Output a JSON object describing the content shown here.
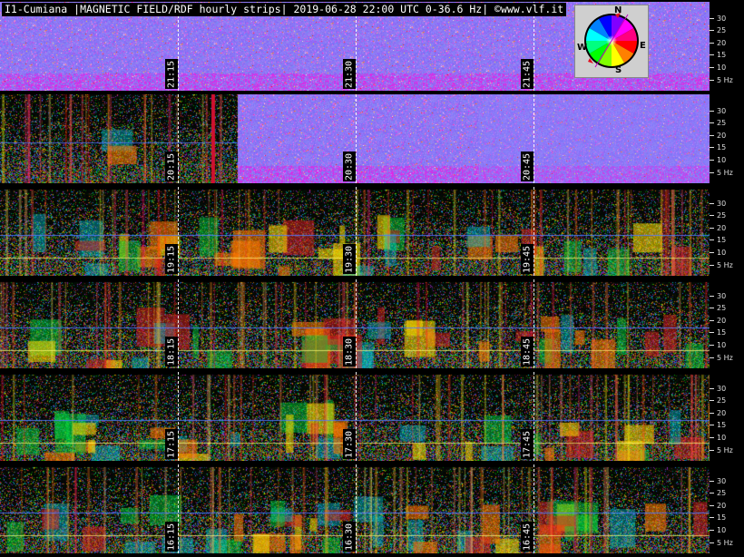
{
  "title": "I1-Cumiana |MAGNETIC FIELD/RDF hourly strips| 2019-06-28 22:00 UTC 0-36.6 Hz| ©www.vlf.it",
  "axis_ticks": [
    "30",
    "25",
    "20",
    "15",
    "10",
    "5 Hz"
  ],
  "compass": {
    "north": "N",
    "south": "S",
    "east": "E",
    "west": "W"
  },
  "strips": [
    {
      "times": [
        "21:15",
        "21:30",
        "21:45"
      ]
    },
    {
      "times": [
        "20:15",
        "20:30",
        "20:45"
      ]
    },
    {
      "times": [
        "19:15",
        "19:30",
        "19:45"
      ]
    },
    {
      "times": [
        "18:15",
        "18:30",
        "18:45"
      ]
    },
    {
      "times": [
        "17:15",
        "17:30",
        "17:45"
      ]
    },
    {
      "times": [
        "16:15",
        "16:30",
        "16:45"
      ]
    }
  ]
}
